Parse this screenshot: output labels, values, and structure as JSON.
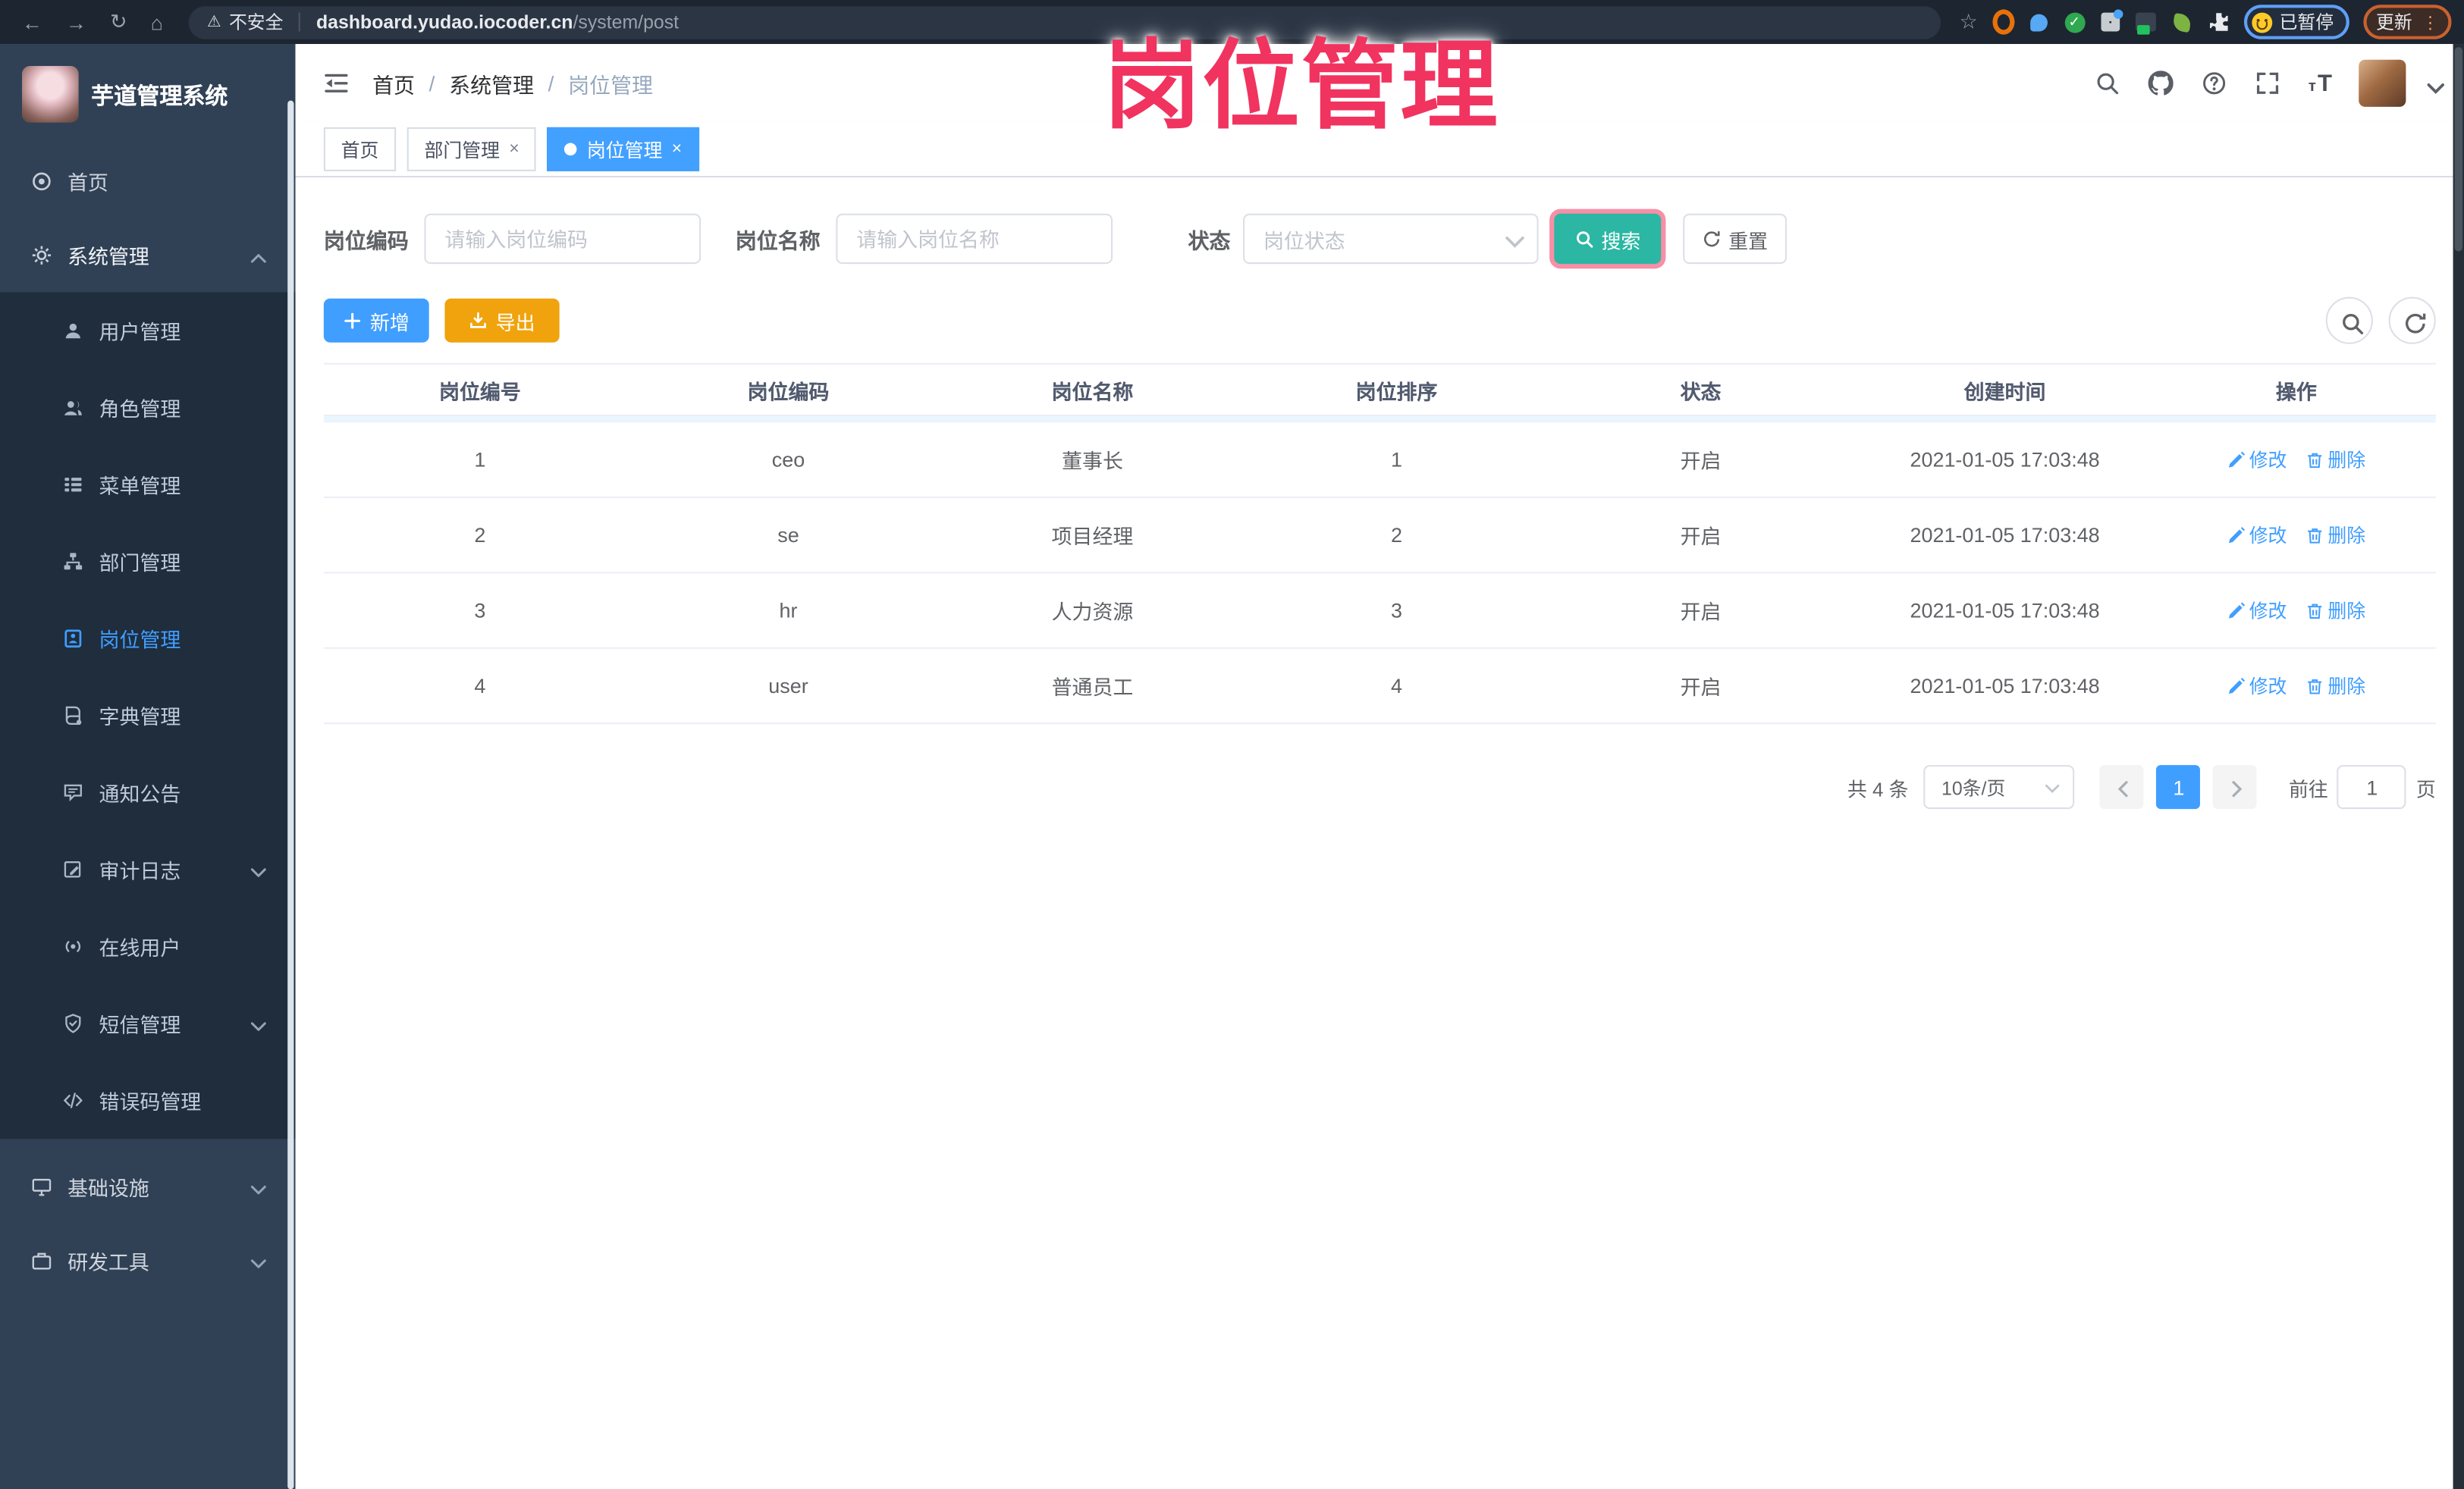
{
  "browser": {
    "security_label": "不安全",
    "url_host": "dashboard.yudao.iocoder.cn",
    "url_path": "/system/post",
    "paused_label": "已暂停",
    "update_label": "更新"
  },
  "icons": {
    "back": "←",
    "forward": "→",
    "reload": "↻",
    "home": "⌂",
    "warning": "⚠",
    "star": "☆",
    "close": "×",
    "dots": "⋮",
    "check": "✓",
    "breadcrumb_sep": "/",
    "font_size_small": "т",
    "font_size_big": "T"
  },
  "overlay_title": "岗位管理",
  "sidebar": {
    "app_title": "芋道管理系统",
    "items": [
      {
        "label": "首页"
      },
      {
        "label": "系统管理"
      },
      {
        "label": "用户管理"
      },
      {
        "label": "角色管理"
      },
      {
        "label": "菜单管理"
      },
      {
        "label": "部门管理"
      },
      {
        "label": "岗位管理"
      },
      {
        "label": "字典管理"
      },
      {
        "label": "通知公告"
      },
      {
        "label": "审计日志"
      },
      {
        "label": "在线用户"
      },
      {
        "label": "短信管理"
      },
      {
        "label": "错误码管理"
      },
      {
        "label": "基础设施"
      },
      {
        "label": "研发工具"
      }
    ]
  },
  "breadcrumb": [
    "首页",
    "系统管理",
    "岗位管理"
  ],
  "tabs": [
    {
      "label": "首页"
    },
    {
      "label": "部门管理"
    },
    {
      "label": "岗位管理"
    }
  ],
  "filters": {
    "code_label": "岗位编码",
    "code_placeholder": "请输入岗位编码",
    "name_label": "岗位名称",
    "name_placeholder": "请输入岗位名称",
    "status_label": "状态",
    "status_placeholder": "岗位状态",
    "search_label": "搜索",
    "reset_label": "重置"
  },
  "toolbar": {
    "add_label": "新增",
    "export_label": "导出"
  },
  "table": {
    "headers": [
      "岗位编号",
      "岗位编码",
      "岗位名称",
      "岗位排序",
      "状态",
      "创建时间",
      "操作"
    ],
    "rows": [
      {
        "id": "1",
        "code": "ceo",
        "name": "董事长",
        "sort": "1",
        "status": "开启",
        "created": "2021-01-05 17:03:48"
      },
      {
        "id": "2",
        "code": "se",
        "name": "项目经理",
        "sort": "2",
        "status": "开启",
        "created": "2021-01-05 17:03:48"
      },
      {
        "id": "3",
        "code": "hr",
        "name": "人力资源",
        "sort": "3",
        "status": "开启",
        "created": "2021-01-05 17:03:48"
      },
      {
        "id": "4",
        "code": "user",
        "name": "普通员工",
        "sort": "4",
        "status": "开启",
        "created": "2021-01-05 17:03:48"
      }
    ],
    "edit_label": "修改",
    "delete_label": "删除"
  },
  "pagination": {
    "total_label": "共 4 条",
    "page_size": "10条/页",
    "current_page": "1",
    "goto_label": "前往",
    "goto_value": "1",
    "page_unit": "页"
  },
  "colors": {
    "accent_blue": "#409eff",
    "search_teal": "#2bb7a3",
    "export_orange": "#f0a30c",
    "overlay_pink": "#f1335f",
    "sidebar_bg": "#304156",
    "submenu_bg": "#1f2d3d"
  }
}
